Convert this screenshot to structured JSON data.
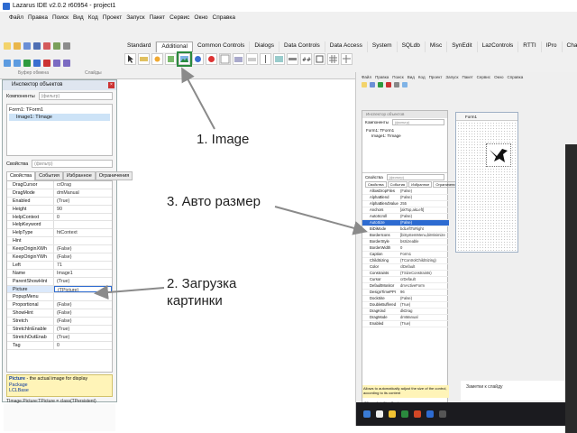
{
  "ide": {
    "title": "Lazarus IDE v2.0.2 r60954 - project1",
    "menu": [
      "Файл",
      "Правка",
      "Поиск",
      "Вид",
      "Код",
      "Проект",
      "Запуск",
      "Пакет",
      "Сервис",
      "Окно",
      "Справка"
    ],
    "palette_tabs": [
      "Standard",
      "Additional",
      "Common Controls",
      "Dialogs",
      "Data Controls",
      "Data Access",
      "System",
      "SQLdb",
      "Misc",
      "SynEdit",
      "LazControls",
      "RTTI",
      "IPro",
      "Chart",
      "Pa"
    ],
    "palette_active_tab": "Additional",
    "sub_labels": [
      "Буфер обмена",
      "Слайды"
    ]
  },
  "inspector": {
    "title": "Инспектор объектов",
    "components_label": "Компоненты",
    "filter_placeholder": "(фильтр)",
    "tree": [
      "Form1: TForm1",
      "Image1: TImage"
    ],
    "properties_label": "Свойства",
    "tabs": [
      "Свойства",
      "События",
      "Избранное",
      "Ограничения"
    ],
    "properties": [
      {
        "name": "DragCursor",
        "value": "crDrag"
      },
      {
        "name": "DragMode",
        "value": "dmManual"
      },
      {
        "name": "Enabled",
        "value": "(True)"
      },
      {
        "name": "Height",
        "value": "90"
      },
      {
        "name": "HelpContext",
        "value": "0"
      },
      {
        "name": "HelpKeyword",
        "value": ""
      },
      {
        "name": "HelpType",
        "value": "htContext"
      },
      {
        "name": "Hint",
        "value": ""
      },
      {
        "name": "KeepOriginXWh",
        "value": "(False)"
      },
      {
        "name": "KeepOriginYWh",
        "value": "(False)"
      },
      {
        "name": "Left",
        "value": "71"
      },
      {
        "name": "Name",
        "value": "Image1"
      },
      {
        "name": "ParentShowHint",
        "value": "(True)"
      },
      {
        "name": "Picture",
        "value": "(TPicture)"
      },
      {
        "name": "PopupMenu",
        "value": ""
      },
      {
        "name": "Proportional",
        "value": "(False)"
      },
      {
        "name": "ShowHint",
        "value": "(False)"
      },
      {
        "name": "Stretch",
        "value": "(False)"
      },
      {
        "name": "StretchInEnable",
        "value": "(True)"
      },
      {
        "name": "StretchOutEnab",
        "value": "(True)"
      },
      {
        "name": "Tag",
        "value": "0"
      }
    ],
    "hint_prop": "Picture",
    "hint_text": "- the actual image for display",
    "hint_package_label": "Package",
    "hint_package": "LCLBase",
    "status": "TImage.Picture:TPicture = class(TPersistent)"
  },
  "shot2": {
    "menu": [
      "Файл",
      "Правка",
      "Поиск",
      "Вид",
      "Код",
      "Проект",
      "Запуск",
      "Пакет",
      "Сервис",
      "Окно",
      "Справка"
    ],
    "inspector_title": "Инспектор объектов",
    "components_label": "Компоненты",
    "filter_placeholder": "(фильтр)",
    "tree": [
      "Form1: TForm1",
      "Image1: TImage"
    ],
    "properties_label": "Свойства",
    "tabs": [
      "Свойства",
      "События",
      "Избранное",
      "Ограничения"
    ],
    "properties": [
      {
        "name": "AllowDropFiles",
        "value": "(False)"
      },
      {
        "name": "AlphaBlend",
        "value": "(False)"
      },
      {
        "name": "AlphaBlendValue",
        "value": "255"
      },
      {
        "name": "Anchors",
        "value": "[akTop,akLeft]"
      },
      {
        "name": "AutoScroll",
        "value": "(False)"
      },
      {
        "name": "AutoSize",
        "value": "(False)"
      },
      {
        "name": "BiDiMode",
        "value": "bdLeftToRight"
      },
      {
        "name": "BorderIcons",
        "value": "[biSystemMenu,biMinimize"
      },
      {
        "name": "BorderStyle",
        "value": "bsSizeable"
      },
      {
        "name": "BorderWidth",
        "value": "0"
      },
      {
        "name": "Caption",
        "value": "Form1"
      },
      {
        "name": "ChildSizing",
        "value": "(TControlChildSizing)"
      },
      {
        "name": "Color",
        "value": "clDefault"
      },
      {
        "name": "Constraints",
        "value": "(TSizeConstraints)"
      },
      {
        "name": "Cursor",
        "value": "crDefault"
      },
      {
        "name": "DefaultMonitor",
        "value": "dmActiveForm"
      },
      {
        "name": "DesignTimePPI",
        "value": "96"
      },
      {
        "name": "DockSite",
        "value": "(False)"
      },
      {
        "name": "DoubleBuffered",
        "value": "(True)"
      },
      {
        "name": "DragKind",
        "value": "dkDrag"
      },
      {
        "name": "DragMode",
        "value": "dmManual"
      },
      {
        "name": "Enabled",
        "value": "(True)"
      }
    ],
    "highlighted_property": "AutoSize",
    "hint_text": "Allows to automatically adjust the size of the control, according to its content",
    "status": "TForm.AutoSize:Boolean",
    "form_title": "Form1",
    "notes_label": "Заметки к слайду"
  },
  "annotations": {
    "image": "1. Image",
    "autosize": "3. Авто размер",
    "load_line1": "2. Загрузка",
    "load_line2": "картинки"
  },
  "colors": {
    "highlight_blue": "#2d6bd1",
    "hint_yellow": "#fff4b8",
    "selected_green": "#2a8a3e",
    "arrow": "#8a8a8a"
  }
}
